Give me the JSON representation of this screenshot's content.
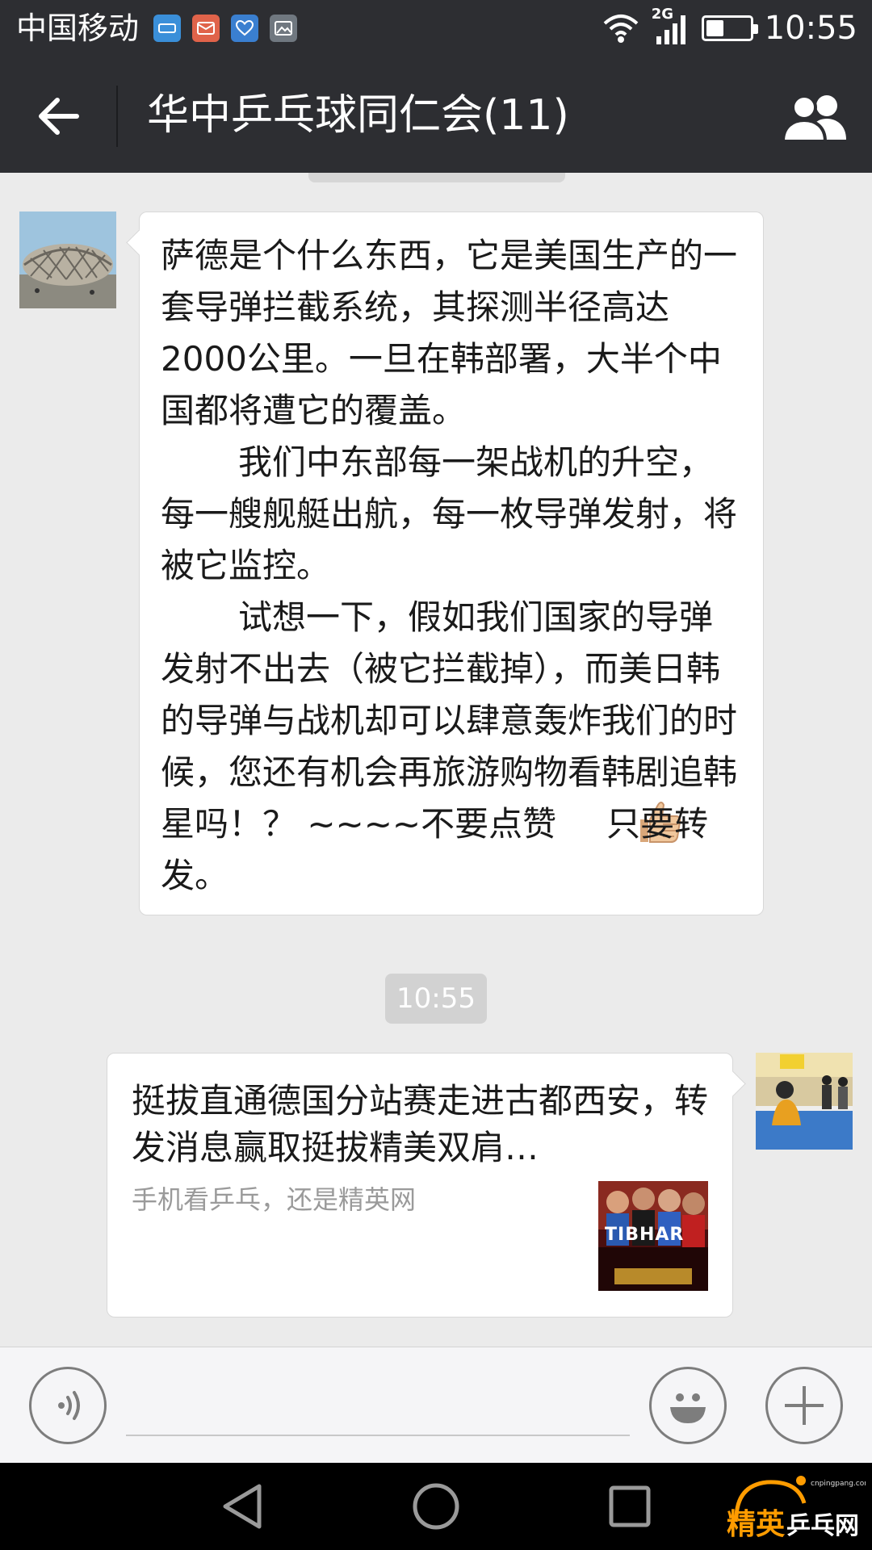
{
  "status_bar": {
    "carrier": "中国移动",
    "network": "2G",
    "time": "10:55",
    "battery_level": 0.4,
    "notification_icons": [
      "app-icon",
      "mail-icon",
      "health-icon",
      "gallery-icon"
    ]
  },
  "header": {
    "title": "华中乒乓球同仁会(11)"
  },
  "messages": {
    "incoming": {
      "paragraph_1": "萨德是个什么东西，它是美国生产的一套导弹拦截系统，其探测半径高达2000公里。一旦在韩部署，大半个中国都将遭它的覆盖。",
      "paragraph_2": "我们中东部每一架战机的升空，每一艘舰艇出航，每一枚导弹发射，将被它监控。",
      "paragraph_3": "试想一下，假如我们国家的导弹发射不出去（被它拦截掉），而美日韩的导弹与战机却可以肆意轰炸我们的时候，您还有机会再旅游购物看韩剧追韩星吗！？ ~~~~不要点赞",
      "paragraph_3_end": "只要转发。"
    },
    "timestamp": "10:55",
    "outgoing_link": {
      "title": "挺拔直通德国分站赛走进古都西安，转发消息赢取挺拔精美双肩…",
      "description": "手机看乒乓，还是精英网",
      "thumbnail_text": "TIBHAR"
    }
  },
  "input_bar": {
    "placeholder": ""
  },
  "watermark": {
    "brand_1": "精英",
    "brand_2": "乒乓网",
    "url": "cnpingpang.com"
  },
  "colors": {
    "bar": "#2d2e32",
    "chat_background": "#ebebeb",
    "bubble": "#ffffff",
    "timestamp_pill": "#d2d2d2",
    "watermark_orange": "#ff9c00"
  }
}
